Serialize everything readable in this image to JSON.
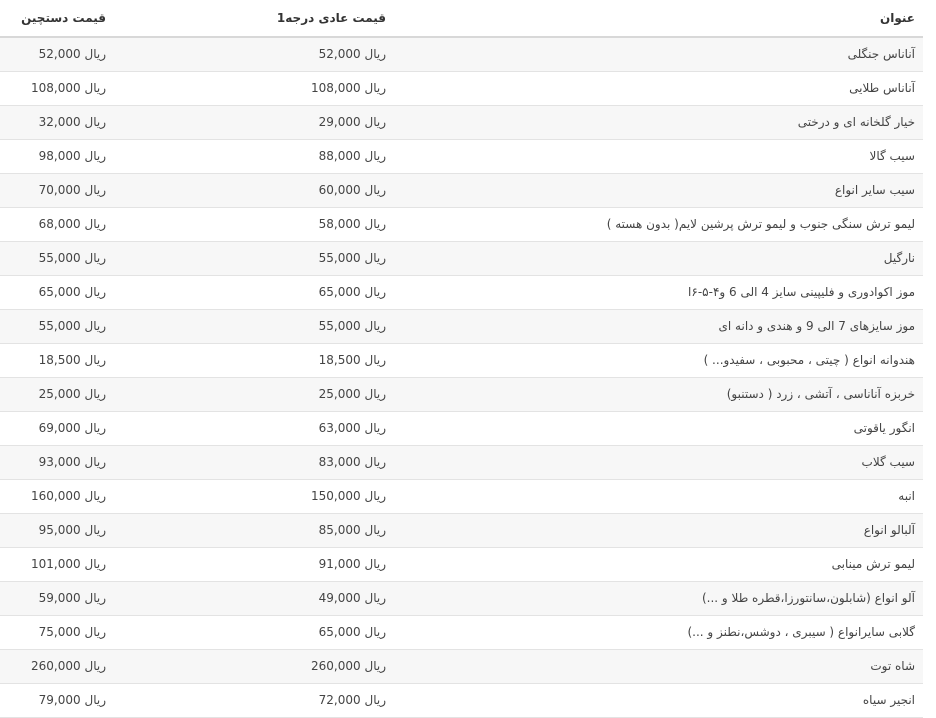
{
  "headers": {
    "distributor_price": "قیمت دستچین",
    "normal_price": "قیمت عادی درجه1",
    "title": "عنوان"
  },
  "currency": "ریال",
  "rows": [
    {
      "title": "آناناس جنگلی",
      "normal": "52,000",
      "dist": "52,000"
    },
    {
      "title": "آناناس طلایی",
      "normal": "108,000",
      "dist": "108,000"
    },
    {
      "title": "خیار گلخانه ای و درختی",
      "normal": "29,000",
      "dist": "32,000"
    },
    {
      "title": "سیب گالا",
      "normal": "88,000",
      "dist": "98,000"
    },
    {
      "title": "سیب سایر انواع",
      "normal": "60,000",
      "dist": "70,000"
    },
    {
      "title": "لیمو ترش سنگی جنوب و لیمو ترش پرشین لایم( بدون هسته )",
      "normal": "58,000",
      "dist": "68,000"
    },
    {
      "title": "نارگیل",
      "normal": "55,000",
      "dist": "55,000"
    },
    {
      "title": "موز اکوادوری و فلیپینی سایز 4 الی 6 و۴-۵-۶ا",
      "normal": "65,000",
      "dist": "65,000"
    },
    {
      "title": "موز سایزهای 7 الی 9 و هندی و دانه ای",
      "normal": "55,000",
      "dist": "55,000"
    },
    {
      "title": "هندوانه انواع ( چیتی ، محبوبی ، سفیدو... )",
      "normal": "18,500",
      "dist": "18,500"
    },
    {
      "title": "خربزه آناناسی ، آتشی ، زرد ( دستنبو)",
      "normal": "25,000",
      "dist": "25,000"
    },
    {
      "title": "انگور یاقوتی",
      "normal": "63,000",
      "dist": "69,000"
    },
    {
      "title": "سیب گلاب",
      "normal": "83,000",
      "dist": "93,000"
    },
    {
      "title": "انبه",
      "normal": "150,000",
      "dist": "160,000"
    },
    {
      "title": "آلبالو انواع",
      "normal": "85,000",
      "dist": "95,000"
    },
    {
      "title": "لیمو ترش مینابی",
      "normal": "91,000",
      "dist": "101,000"
    },
    {
      "title": "آلو انواع (شابلون،سانتورزا،قطره طلا و ...)",
      "normal": "49,000",
      "dist": "59,000"
    },
    {
      "title": "گلابی سایرانواع ( سیبری ، دوشس،نطنز و ...)",
      "normal": "65,000",
      "dist": "75,000"
    },
    {
      "title": "شاه توت",
      "normal": "260,000",
      "dist": "260,000"
    },
    {
      "title": "انجیر سیاه",
      "normal": "72,000",
      "dist": "79,000"
    }
  ]
}
